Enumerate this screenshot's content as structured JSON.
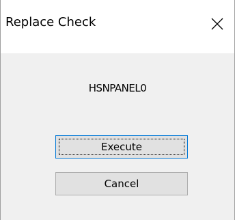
{
  "window": {
    "title": "Replace Check",
    "close_icon": "close-icon"
  },
  "message": "HSNPANEL0",
  "buttons": {
    "execute_label": "Execute",
    "cancel_label": "Cancel"
  },
  "colors": {
    "title_bg": "#ffffff",
    "dialog_bg": "#f0f0f0",
    "button_bg": "#e1e1e1",
    "button_border": "#adadad",
    "default_button_border": "#0078d7"
  }
}
